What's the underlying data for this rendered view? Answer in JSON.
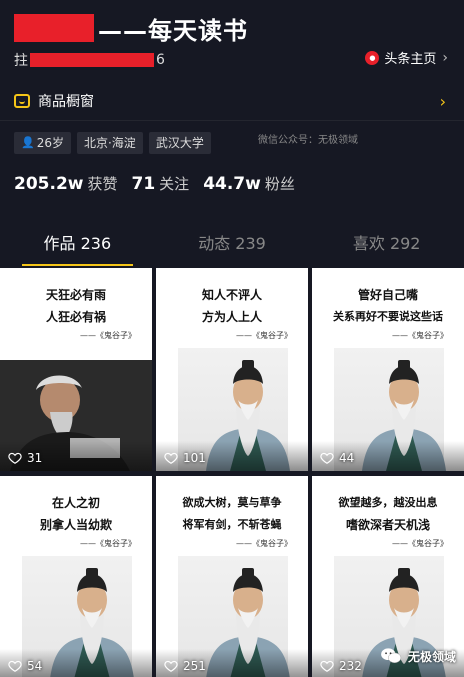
{
  "header": {
    "title": "——每天读书",
    "id_prefix": "拄",
    "id_suffix": "6",
    "toutiao_label": "头条主页",
    "toutiao_icon": "toutiao-icon"
  },
  "shop": {
    "label": "商品橱窗"
  },
  "tags": {
    "age": "26岁",
    "location": "北京·海淀",
    "school": "武汉大学"
  },
  "watermark_text": "微信公众号：无极领域",
  "stats": [
    {
      "num": "205.2w",
      "label": "获赞"
    },
    {
      "num": "71",
      "label": "关注"
    },
    {
      "num": "44.7w",
      "label": "粉丝"
    }
  ],
  "tabs": [
    {
      "label": "作品 236",
      "active": true
    },
    {
      "label": "动态 239",
      "active": false
    },
    {
      "label": "喜欢 292",
      "active": false
    }
  ],
  "posts": [
    {
      "lines": [
        "天狂必有雨",
        "人狂必有祸"
      ],
      "source": "——《鬼谷子》",
      "likes": "31",
      "image": "dark-portrait"
    },
    {
      "lines": [
        "知人不评人",
        "方为人上人"
      ],
      "source": "——《鬼谷子》",
      "likes": "101",
      "image": "sage-portrait"
    },
    {
      "lines": [
        "管好自己嘴",
        "关系再好不要说这些话"
      ],
      "source": "——《鬼谷子》",
      "likes": "44",
      "image": "sage-portrait"
    },
    {
      "lines": [
        "在人之初",
        "别拿人当幼欺"
      ],
      "source": "——《鬼谷子》",
      "likes": "54",
      "image": "sage-portrait"
    },
    {
      "lines": [
        "欲成大树，莫与草争",
        "将军有剑，不斩苍蝇"
      ],
      "source": "——《鬼谷子》",
      "likes": "251",
      "image": "sage-portrait"
    },
    {
      "lines": [
        "欲望越多，越没出息",
        "嗜欲深者天机浅"
      ],
      "source": "——《鬼谷子》",
      "likes": "232",
      "image": "sage-portrait"
    }
  ],
  "wechat_badge": "无极领域",
  "colors": {
    "background": "#161823",
    "accent": "#f5c518",
    "redaction": "#e8202a",
    "tag_bg": "#2a2c37"
  }
}
